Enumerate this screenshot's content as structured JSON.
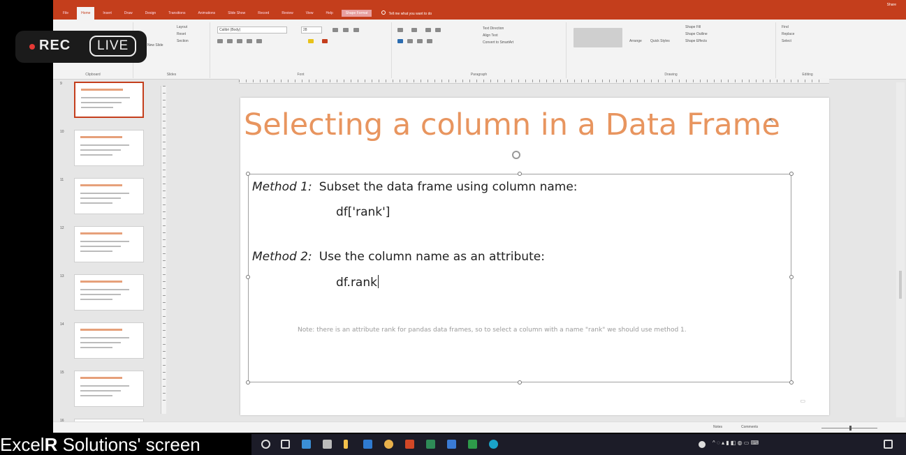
{
  "powerpoint": {
    "tabs": [
      {
        "label": "File",
        "active": false
      },
      {
        "label": "Home",
        "active": true
      },
      {
        "label": "Insert",
        "active": false
      },
      {
        "label": "Draw",
        "active": false
      },
      {
        "label": "Design",
        "active": false
      },
      {
        "label": "Transitions",
        "active": false
      },
      {
        "label": "Animations",
        "active": false
      },
      {
        "label": "Slide Show",
        "active": false
      },
      {
        "label": "Record",
        "active": false
      },
      {
        "label": "Review",
        "active": false
      },
      {
        "label": "View",
        "active": false
      },
      {
        "label": "Help",
        "active": false
      },
      {
        "label": "Shape Format",
        "active": false
      }
    ],
    "tell_me": "Tell me what you want to do",
    "share": "Share",
    "ribbon": {
      "clipboard_label": "Clipboard",
      "slides_label": "Slides",
      "font_label": "Font",
      "paragraph_label": "Paragraph",
      "drawing_label": "Drawing",
      "editing_label": "Editing",
      "layout": "Layout",
      "reset": "Reset",
      "section": "Section",
      "new_slide": "New Slide",
      "font_name": "Calibri (Body)",
      "font_size": "28",
      "text_direction": "Text Direction",
      "align_text": "Align Text",
      "convert_smartart": "Convert to SmartArt",
      "arrange": "Arrange",
      "quick_styles": "Quick Styles",
      "shape_fill": "Shape Fill",
      "shape_outline": "Shape Outline",
      "shape_effects": "Shape Effects",
      "find": "Find",
      "replace": "Replace",
      "select": "Select"
    },
    "thumbnail_numbers": [
      "9",
      "10",
      "11",
      "12",
      "13",
      "14",
      "15",
      "16"
    ],
    "slide": {
      "title": "Selecting a column in a Data Frame",
      "method1_label": "Method 1:",
      "method1_text": "Subset the data frame using column name:",
      "method1_code": "df['rank']",
      "method2_label": "Method 2:",
      "method2_text": "Use the column name as an attribute:",
      "method2_code": "df.rank",
      "note": "Note: there is an attribute rank for pandas data frames, so to select a column with a name \"rank\" we should use method 1."
    },
    "status": {
      "notes": "Notes",
      "comments": "Comments"
    }
  },
  "recording": {
    "rec_label": "REC",
    "live_label": "LIVE"
  },
  "caption": {
    "brand": "Excel",
    "brand_r": "R",
    "rest": " Solutions' screen"
  },
  "colors": {
    "accent": "#c43e1c",
    "title_orange": "#e8955f",
    "rec_red": "#e53935"
  }
}
